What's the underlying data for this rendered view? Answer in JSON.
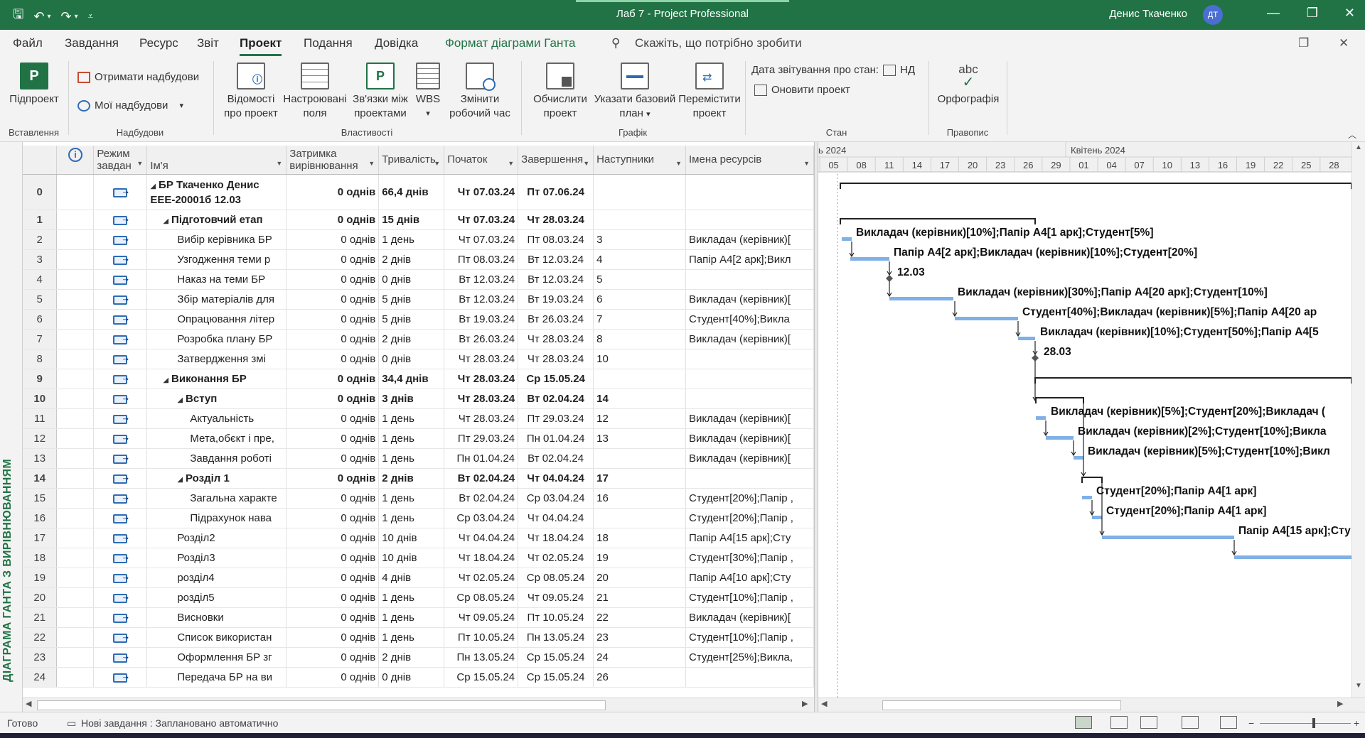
{
  "window": {
    "title": "Лаб 7  -  Project Professional",
    "user": "Денис Ткаченко",
    "user_initials": "ДТ"
  },
  "tabs": [
    {
      "label": "Файл"
    },
    {
      "label": "Завдання"
    },
    {
      "label": "Ресурс"
    },
    {
      "label": "Звіт"
    },
    {
      "label": "Проект"
    },
    {
      "label": "Подання"
    },
    {
      "label": "Довідка"
    },
    {
      "label": "Формат діаграми Ганта"
    }
  ],
  "search": {
    "placeholder": "Скажіть, що потрібно зробити"
  },
  "ribbon": {
    "insert": {
      "group": "Вставлення",
      "subproject": "Підпроект"
    },
    "addins": {
      "group": "Надбудови",
      "get": "Отримати надбудови",
      "my": "Мої надбудови"
    },
    "props": {
      "group": "Властивості",
      "info_l1": "Відомості",
      "info_l2": "про проект",
      "fields_l1": "Настроювані",
      "fields_l2": "поля",
      "links_l1": "Зв'язки між",
      "links_l2": "проектами",
      "wbs": "WBS",
      "worktime_l1": "Змінити",
      "worktime_l2": "робочий час"
    },
    "schedule": {
      "group": "Графік",
      "calc_l1": "Обчислити",
      "calc_l2": "проект",
      "baseline_l1": "Указати базовий",
      "baseline_l2": "план",
      "move_l1": "Перемістити",
      "move_l2": "проект"
    },
    "status": {
      "group": "Стан",
      "status_date_label": "Дата звітування про стан:",
      "status_date_value": "НД",
      "update": "Оновити проект"
    },
    "proofing": {
      "group": "Правопис",
      "spell": "Орфографія",
      "abc": "abc"
    }
  },
  "view_label": "ДІАГРАМА ГАНТА З ВИРІВНЮВАННЯМ",
  "columns": {
    "mode_l1": "Режим",
    "mode_l2": "завдан",
    "name": "Ім'я",
    "lag_l1": "Затримка",
    "lag_l2": "вирівнювання",
    "duration": "Тривалість",
    "start": "Початок",
    "finish": "Завершення",
    "successors": "Наступники",
    "resources": "Імена ресурсів"
  },
  "tasks": [
    {
      "id": "0",
      "name": "БР Ткаченко Денис ЕЕЕ-20001б 12.03",
      "lag": "0 однів",
      "dur": "66,4 днів",
      "start": "Чт 07.03.24",
      "finish": "Пт 07.06.24",
      "succ": "",
      "res": "",
      "summary": true,
      "indent": 0
    },
    {
      "id": "1",
      "name": "Підготовчий етап",
      "lag": "0 однів",
      "dur": "15 днів",
      "start": "Чт 07.03.24",
      "finish": "Чт 28.03.24",
      "succ": "",
      "res": "",
      "summary": true,
      "indent": 1
    },
    {
      "id": "2",
      "name": "Вибір керівника БР",
      "lag": "0 однів",
      "dur": "1 день",
      "start": "Чт 07.03.24",
      "finish": "Пт 08.03.24",
      "succ": "3",
      "res": "Викладач (керівник)[",
      "summary": false,
      "indent": 2
    },
    {
      "id": "3",
      "name": "Узгодження теми р",
      "lag": "0 однів",
      "dur": "2 днів",
      "start": "Пт 08.03.24",
      "finish": "Вт 12.03.24",
      "succ": "4",
      "res": "Папір А4[2 арк];Викл",
      "summary": false,
      "indent": 2
    },
    {
      "id": "4",
      "name": "Наказ на теми БР",
      "lag": "0 однів",
      "dur": "0 днів",
      "start": "Вт 12.03.24",
      "finish": "Вт 12.03.24",
      "succ": "5",
      "res": "",
      "summary": false,
      "indent": 2
    },
    {
      "id": "5",
      "name": "Збір матеріалів для",
      "lag": "0 однів",
      "dur": "5 днів",
      "start": "Вт 12.03.24",
      "finish": "Вт 19.03.24",
      "succ": "6",
      "res": "Викладач (керівник)[",
      "summary": false,
      "indent": 2
    },
    {
      "id": "6",
      "name": "Опрацювання літер",
      "lag": "0 однів",
      "dur": "5 днів",
      "start": "Вт 19.03.24",
      "finish": "Вт 26.03.24",
      "succ": "7",
      "res": "Студент[40%];Викла",
      "summary": false,
      "indent": 2
    },
    {
      "id": "7",
      "name": "Розробка плану БР",
      "lag": "0 однів",
      "dur": "2 днів",
      "start": "Вт 26.03.24",
      "finish": "Чт 28.03.24",
      "succ": "8",
      "res": "Викладач (керівник)[",
      "summary": false,
      "indent": 2
    },
    {
      "id": "8",
      "name": "Затвердження змі",
      "lag": "0 однів",
      "dur": "0 днів",
      "start": "Чт 28.03.24",
      "finish": "Чт 28.03.24",
      "succ": "10",
      "res": "",
      "summary": false,
      "indent": 2
    },
    {
      "id": "9",
      "name": "Виконання БР",
      "lag": "0 однів",
      "dur": "34,4 днів",
      "start": "Чт 28.03.24",
      "finish": "Ср 15.05.24",
      "succ": "",
      "res": "",
      "summary": true,
      "indent": 1
    },
    {
      "id": "10",
      "name": "Вступ",
      "lag": "0 однів",
      "dur": "3 днів",
      "start": "Чт 28.03.24",
      "finish": "Вт 02.04.24",
      "succ": "14",
      "res": "",
      "summary": true,
      "indent": 2
    },
    {
      "id": "11",
      "name": "Актуальність",
      "lag": "0 однів",
      "dur": "1 день",
      "start": "Чт 28.03.24",
      "finish": "Пт 29.03.24",
      "succ": "12",
      "res": "Викладач (керівник)[",
      "summary": false,
      "indent": 3
    },
    {
      "id": "12",
      "name": "Мета,обєкт і пре,",
      "lag": "0 однів",
      "dur": "1 день",
      "start": "Пт 29.03.24",
      "finish": "Пн 01.04.24",
      "succ": "13",
      "res": "Викладач (керівник)[",
      "summary": false,
      "indent": 3
    },
    {
      "id": "13",
      "name": "Завдання роботі",
      "lag": "0 однів",
      "dur": "1 день",
      "start": "Пн 01.04.24",
      "finish": "Вт 02.04.24",
      "succ": "",
      "res": "Викладач (керівник)[",
      "summary": false,
      "indent": 3
    },
    {
      "id": "14",
      "name": "Розділ 1",
      "lag": "0 однів",
      "dur": "2 днів",
      "start": "Вт 02.04.24",
      "finish": "Чт 04.04.24",
      "succ": "17",
      "res": "",
      "summary": true,
      "indent": 2
    },
    {
      "id": "15",
      "name": "Загальна характе",
      "lag": "0 однів",
      "dur": "1 день",
      "start": "Вт 02.04.24",
      "finish": "Ср 03.04.24",
      "succ": "16",
      "res": "Студент[20%];Папір ,",
      "summary": false,
      "indent": 3
    },
    {
      "id": "16",
      "name": "Підрахунок нава",
      "lag": "0 однів",
      "dur": "1 день",
      "start": "Ср 03.04.24",
      "finish": "Чт 04.04.24",
      "succ": "",
      "res": "Студент[20%];Папір ,",
      "summary": false,
      "indent": 3
    },
    {
      "id": "17",
      "name": "Розділ2",
      "lag": "0 однів",
      "dur": "10 днів",
      "start": "Чт 04.04.24",
      "finish": "Чт 18.04.24",
      "succ": "18",
      "res": "Папір А4[15 арк];Сту",
      "summary": false,
      "indent": 2
    },
    {
      "id": "18",
      "name": "Розділ3",
      "lag": "0 однів",
      "dur": "10 днів",
      "start": "Чт 18.04.24",
      "finish": "Чт 02.05.24",
      "succ": "19",
      "res": "Студент[30%];Папір ,",
      "summary": false,
      "indent": 2
    },
    {
      "id": "19",
      "name": "розділ4",
      "lag": "0 однів",
      "dur": "4 днів",
      "start": "Чт 02.05.24",
      "finish": "Ср 08.05.24",
      "succ": "20",
      "res": "Папір А4[10 арк];Сту",
      "summary": false,
      "indent": 2
    },
    {
      "id": "20",
      "name": "розділ5",
      "lag": "0 однів",
      "dur": "1 день",
      "start": "Ср 08.05.24",
      "finish": "Чт 09.05.24",
      "succ": "21",
      "res": "Студент[10%];Папір ,",
      "summary": false,
      "indent": 2
    },
    {
      "id": "21",
      "name": "Висновки",
      "lag": "0 однів",
      "dur": "1 день",
      "start": "Чт 09.05.24",
      "finish": "Пт 10.05.24",
      "succ": "22",
      "res": "Викладач (керівник)[",
      "summary": false,
      "indent": 2
    },
    {
      "id": "22",
      "name": "Список використан",
      "lag": "0 однів",
      "dur": "1 день",
      "start": "Пт 10.05.24",
      "finish": "Пн 13.05.24",
      "succ": "23",
      "res": "Студент[10%];Папір ,",
      "summary": false,
      "indent": 2
    },
    {
      "id": "23",
      "name": "Оформлення БР зг",
      "lag": "0 однів",
      "dur": "2 днів",
      "start": "Пн 13.05.24",
      "finish": "Ср 15.05.24",
      "succ": "24",
      "res": "Студент[25%];Викла,",
      "summary": false,
      "indent": 2
    },
    {
      "id": "24",
      "name": "Передача БР на ви",
      "lag": "0 однів",
      "dur": "0 днів",
      "start": "Ср 15.05.24",
      "finish": "Ср 15.05.24",
      "succ": "26",
      "res": "",
      "summary": false,
      "indent": 2
    }
  ],
  "timescale": {
    "month_left": "ь 2024",
    "month_right": "Квітень 2024",
    "days": [
      "05",
      "08",
      "11",
      "14",
      "17",
      "20",
      "23",
      "26",
      "29",
      "01",
      "04",
      "07",
      "10",
      "13",
      "16",
      "19",
      "22",
      "25",
      "28"
    ]
  },
  "gantt_labels": [
    "Викладач (керівник)[10%];Папір А4[1 арк];Студент[5%]",
    "Папір А4[2 арк];Викладач (керівник)[10%];Студент[20%]",
    "12.03",
    "Викладач (керівник)[30%];Папір А4[20 арк];Студент[10%]",
    "Студент[40%];Викладач (керівник)[5%];Папір А4[20 ар",
    "Викладач (керівник)[10%];Студент[50%];Папір А4[5",
    "28.03",
    "Викладач (керівник)[5%];Студент[20%];Викладач (",
    "Викладач (керівник)[2%];Студент[10%];Викла",
    "Викладач (керівник)[5%];Студент[10%];Викл",
    "Студент[20%];Папір А4[1 арк]",
    "Студент[20%];Папір А4[1 арк]",
    "Папір А4[15 арк];Сту"
  ],
  "statusbar": {
    "ready": "Готово",
    "new_tasks": "Нові завдання : Заплановано автоматично"
  },
  "colors": {
    "accent": "#217346",
    "bar": "#7fb0e6",
    "link": "#222222"
  }
}
